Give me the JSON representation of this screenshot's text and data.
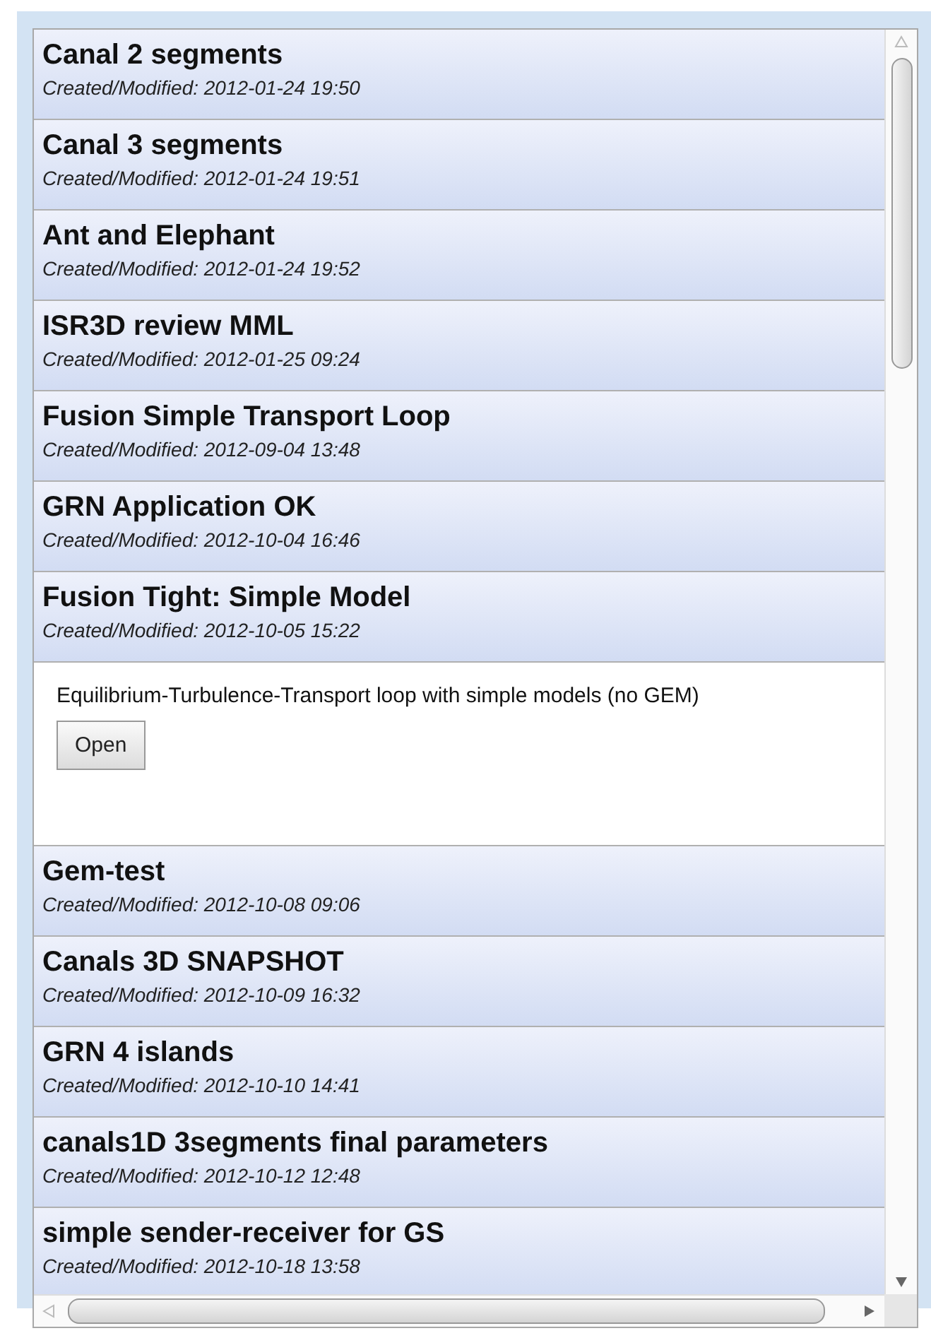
{
  "items": [
    {
      "title": "Canal 2 segments",
      "date": "Created/Modified: 2012-01-24 19:50"
    },
    {
      "title": "Canal 3 segments",
      "date": "Created/Modified: 2012-01-24 19:51"
    },
    {
      "title": "Ant and Elephant",
      "date": "Created/Modified: 2012-01-24 19:52"
    },
    {
      "title": "ISR3D review MML",
      "date": "Created/Modified: 2012-01-25 09:24"
    },
    {
      "title": "Fusion Simple Transport Loop",
      "date": "Created/Modified: 2012-09-04 13:48"
    },
    {
      "title": "GRN Application OK",
      "date": "Created/Modified: 2012-10-04 16:46"
    },
    {
      "title": "Fusion Tight: Simple Model",
      "date": "Created/Modified: 2012-10-05 15:22",
      "description": "Equilibrium-Turbulence-Transport loop with simple models (no GEM)",
      "button": "Open"
    },
    {
      "title": "Gem-test",
      "date": "Created/Modified: 2012-10-08 09:06"
    },
    {
      "title": "Canals 3D SNAPSHOT",
      "date": "Created/Modified: 2012-10-09 16:32"
    },
    {
      "title": "GRN 4 islands",
      "date": "Created/Modified: 2012-10-10 14:41"
    },
    {
      "title": "canals1D 3segments final parameters",
      "date": "Created/Modified: 2012-10-12 12:48"
    },
    {
      "title": "simple sender-receiver for GS",
      "date": "Created/Modified: 2012-10-18 13:58"
    }
  ]
}
